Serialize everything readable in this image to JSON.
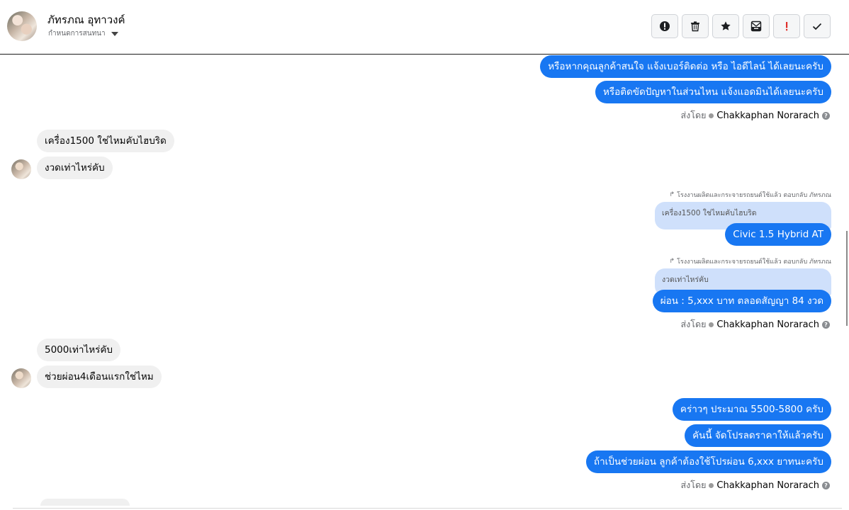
{
  "header": {
    "contact_name": "ภัทรภณ อุทาวงค์",
    "assign_label": "กำหนดการสนทนา",
    "actions": [
      {
        "name": "alert-icon"
      },
      {
        "name": "trash-icon"
      },
      {
        "name": "star-icon"
      },
      {
        "name": "mail-archive-icon"
      },
      {
        "name": "exclamation-icon"
      },
      {
        "name": "check-icon"
      }
    ]
  },
  "messages": {
    "m1": "หรือหากคุณลูกค้าสนใจ แจ้งเบอร์ติดต่อ หรือ ไอดีไลน์ ได้เลยนะครับ",
    "m2": "หรือติดขัดปัญหาในส่วนไหน แจ้งแอดมินได้เลยนะครับ",
    "in1": "เครื่อง1500 ใช่ไหมคับไฮบริด",
    "in2": "งวดเท่าไหร่คับ",
    "reply_note": "โรงงานผลิตและกระจายรถยนต์ใช้แล้ว ตอบกลับ ภัทรภณ",
    "quote1": "เครื่อง1500 ใช่ไหมคับไฮบริด",
    "m3": "Civic 1.5 Hybrid AT",
    "quote2": "งวดเท่าไหร่คับ",
    "m4": "ผ่อน : 5,xxx บาท ตลอดสัญญา 84 งวด",
    "in3": "5000เท่าไหร่คับ",
    "in4": "ช่วยผ่อน4เดือนแรกใช่ไหม",
    "m5": "คร่าวๆ ประมาณ 5500-5800 ครับ",
    "m6": "คันนี้ จัดโปรลดราคาให้แล้วครับ",
    "m7": "ถ้าเป็นช่วยผ่อน ลูกค้าต้องใช้โปรผ่อน 6,xxx ยาทนะครับ"
  },
  "sent_by": {
    "label": "ส่งโดย",
    "name": "Chakkaphan Norarach"
  },
  "colors": {
    "outgoing": "#1877f2",
    "incoming": "#f0f0f0",
    "quoted": "#cfe0fb"
  }
}
